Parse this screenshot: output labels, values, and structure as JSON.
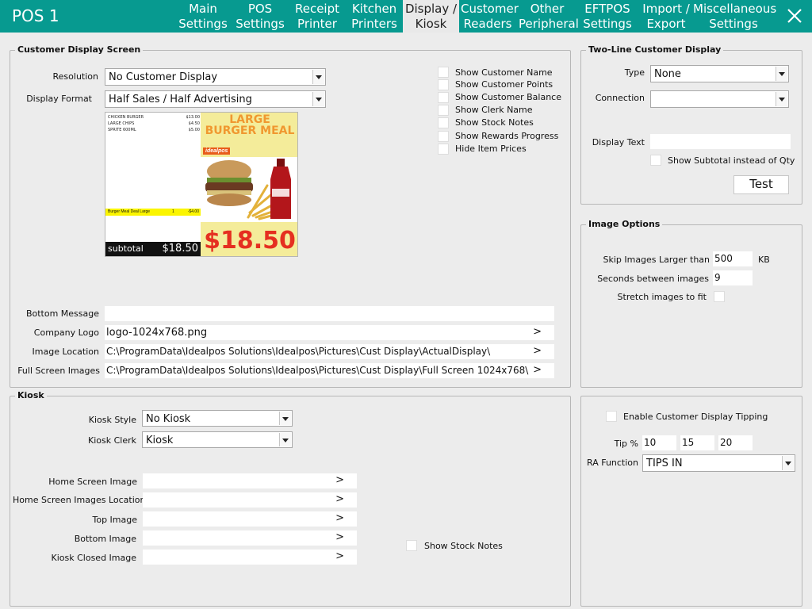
{
  "app": {
    "title": "POS 1"
  },
  "tabs": [
    {
      "line1": "Main",
      "line2": "Settings"
    },
    {
      "line1": "POS",
      "line2": "Settings"
    },
    {
      "line1": "Receipt",
      "line2": "Printer"
    },
    {
      "line1": "Kitchen",
      "line2": "Printers"
    },
    {
      "line1": "Display /",
      "line2": "Kiosk"
    },
    {
      "line1": "Customer",
      "line2": "Readers"
    },
    {
      "line1": "Other",
      "line2": "Peripheral"
    },
    {
      "line1": "EFTPOS",
      "line2": "Settings"
    },
    {
      "line1": "Import /",
      "line2": "Export"
    },
    {
      "line1": "Miscellaneous",
      "line2": "Settings"
    }
  ],
  "customer_display": {
    "title": "Customer Display Screen",
    "resolution_label": "Resolution",
    "resolution_value": "No Customer Display",
    "format_label": "Display Format",
    "format_value": "Half Sales / Half Advertising",
    "checkboxes": [
      "Show Customer Name",
      "Show Customer Points",
      "Show Customer Balance",
      "Show Clerk Name",
      "Show Stock Notes",
      "Show Rewards Progress",
      "Hide Item Prices"
    ],
    "preview": {
      "items": [
        {
          "name": "CHICKEN BURGER",
          "price": "$13.00"
        },
        {
          "name": "LARGE CHIPS",
          "price": "$4.50"
        },
        {
          "name": "SPRITE 600ML",
          "price": "$5.00"
        }
      ],
      "highlight_name": "Burger Meal Deal Large",
      "highlight_qty": "1",
      "highlight_price": "-$4.00",
      "subtotal_label": "subtotal",
      "subtotal_value": "$18.50",
      "ad_line1": "LARGE",
      "ad_line2": "BURGER MEAL",
      "ad_badge": "idealpos",
      "ad_price": "$18.50"
    },
    "bottom_message_label": "Bottom Message",
    "bottom_message_value": "",
    "company_logo_label": "Company Logo",
    "company_logo_value": "logo-1024x768.png",
    "image_location_label": "Image Location",
    "image_location_value": "C:\\ProgramData\\Idealpos Solutions\\Idealpos\\Pictures\\Cust Display\\ActualDisplay\\",
    "full_screen_label": "Full Screen Images",
    "full_screen_value": "C:\\ProgramData\\Idealpos Solutions\\Idealpos\\Pictures\\Cust Display\\Full Screen 1024x768\\",
    "browse_glyph": ">"
  },
  "two_line": {
    "title": "Two-Line Customer Display",
    "type_label": "Type",
    "type_value": "None",
    "connection_label": "Connection",
    "connection_value": "",
    "display_text_label": "Display Text",
    "display_text_value": "",
    "subtotal_checkbox": "Show Subtotal instead of Qty",
    "test_button": "Test"
  },
  "image_options": {
    "title": "Image Options",
    "skip_label": "Skip Images Larger than",
    "skip_value": "500",
    "skip_unit": "KB",
    "seconds_label": "Seconds between images",
    "seconds_value": "9",
    "stretch_label": "Stretch images to fit"
  },
  "kiosk": {
    "title": "Kiosk",
    "style_label": "Kiosk Style",
    "style_value": "No Kiosk",
    "clerk_label": "Kiosk Clerk",
    "clerk_value": "Kiosk",
    "home_screen_image_label": "Home Screen Image",
    "home_screen_images_location_label": "Home Screen Images Location",
    "top_image_label": "Top Image",
    "bottom_image_label": "Bottom Image",
    "kiosk_closed_image_label": "Kiosk Closed Image",
    "show_stock_notes": "Show Stock Notes"
  },
  "tipping": {
    "enable_label": "Enable Customer Display Tipping",
    "tip_label": "Tip %",
    "tip_values": [
      "10",
      "15",
      "20"
    ],
    "ra_label": "RA Function",
    "ra_value": "TIPS IN"
  }
}
